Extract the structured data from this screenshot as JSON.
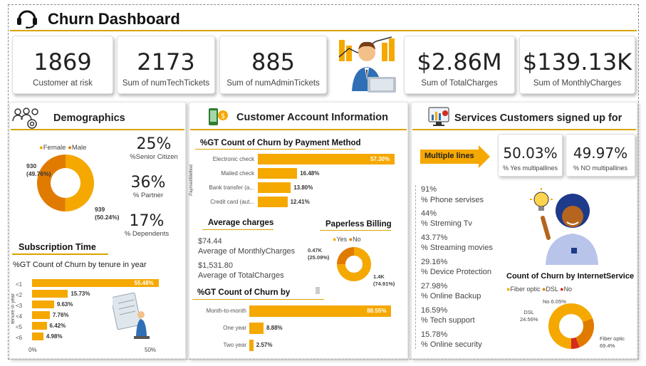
{
  "header": {
    "title": "Churn Dashboard"
  },
  "kpis": [
    {
      "value": "1869",
      "label": "Customer at risk"
    },
    {
      "value": "2173",
      "label": "Sum of numTechTickets"
    },
    {
      "value": "885",
      "label": "Sum of numAdminTickets"
    },
    {
      "value": "$2.86M",
      "label": "Sum of TotalCharges"
    },
    {
      "value": "$139.13K",
      "label": "Sum of MonthlyCharges"
    }
  ],
  "demographics": {
    "title": "Demographics",
    "legend": [
      "Female",
      "Male"
    ],
    "female_label": "939\n(50.24%)",
    "male_label": "930\n(49.76%)",
    "stats": [
      {
        "value": "25%",
        "label": "%Senior Citizen"
      },
      {
        "value": "36%",
        "label": "% Partner"
      },
      {
        "value": "17%",
        "label": "% Dependents"
      }
    ],
    "subscription_title": "Subscription Time",
    "tenure_title": "%GT Count of Churn by tenure in year",
    "tenure_axis": "tenure in year",
    "tenure_x_ticks": [
      "0%",
      "50%"
    ]
  },
  "account": {
    "title": "Customer Account Information",
    "payment_title": "%GT Count of Churn by Payment Method",
    "payment_axis": "PaymentMethod",
    "avg_title": "Average charges",
    "avg_monthly_value": "$74.44",
    "avg_monthly_label": "Average of MonthlyCharges",
    "avg_total_value": "$1,531.80",
    "avg_total_label": "Average of TotalCharges",
    "paperless_title": "Paperless Billing",
    "paperless_legend": [
      "Yes",
      "No"
    ],
    "paperless_no_label": "0.47K\n(25.09%)",
    "paperless_yes_label": "1.4K\n(74.91%)",
    "contract_title": "%GT Count of Churn by"
  },
  "services": {
    "title": "Services Customers signed up for",
    "multiple_lines": "Multiple lines",
    "yes_multi_value": "50.03%",
    "yes_multi_label": "% Yes multipallines",
    "no_multi_value": "49.97%",
    "no_multi_label": "% NO multipallines",
    "list": [
      {
        "pct": "91%",
        "label": "% Phone servises"
      },
      {
        "pct": "44%",
        "label": "% Streming Tv"
      },
      {
        "pct": "43.77%",
        "label": "% Streaming movies"
      },
      {
        "pct": "29.16%",
        "label": "% Device Protection"
      },
      {
        "pct": "27.98%",
        "label": "% Online Backup"
      },
      {
        "pct": "16.59%",
        "label": "% Tech support"
      },
      {
        "pct": "15.78%",
        "label": "% Online security"
      }
    ],
    "internet_title": "Count of Churn by InternetService",
    "internet_legend": [
      "Fiber optic",
      "DSL",
      "No"
    ],
    "internet_labels": {
      "no": "No 6.05%",
      "dsl": "DSL\n24.56%",
      "fiber": "Fiber optic\n69.4%"
    }
  },
  "colors": {
    "accent": "#f5a800",
    "dark": "#e07b00",
    "red": "#d62b1f"
  },
  "chart_data": [
    {
      "type": "pie",
      "title": "",
      "categories": [
        "Female",
        "Male"
      ],
      "values": [
        939,
        930
      ],
      "percent": [
        50.24,
        49.76
      ]
    },
    {
      "type": "bar",
      "title": "%GT Count of Churn by tenure in year",
      "categories": [
        "<1",
        "<2",
        "<3",
        "<4",
        "<5",
        "<6"
      ],
      "values": [
        55.48,
        15.73,
        9.63,
        7.76,
        6.42,
        4.98
      ],
      "labels": [
        "55.48%",
        "15.73%",
        "9.63%",
        "7.76%",
        "6.42%",
        "4.98%"
      ],
      "ylabel": "tenure in year",
      "xlim": [
        0,
        60
      ]
    },
    {
      "type": "bar",
      "title": "%GT Count of Churn by Payment Method",
      "categories": [
        "Electronic check",
        "Mailed check",
        "Bank transfer (a...",
        "Credit card (aut..."
      ],
      "values": [
        57.3,
        16.48,
        13.8,
        12.41
      ],
      "labels": [
        "57.30%",
        "16.48%",
        "13.80%",
        "12.41%"
      ],
      "ylabel": "PaymentMethod"
    },
    {
      "type": "pie",
      "title": "Paperless Billing",
      "categories": [
        "Yes",
        "No"
      ],
      "values": [
        1400,
        470
      ],
      "percent": [
        74.91,
        25.09
      ]
    },
    {
      "type": "bar",
      "title": "%GT Count of Churn by",
      "categories": [
        "Month-to-month",
        "One year",
        "Two year"
      ],
      "values": [
        88.55,
        8.88,
        2.57
      ],
      "labels": [
        "88.55%",
        "8.88%",
        "2.57%"
      ]
    },
    {
      "type": "pie",
      "title": "Count of Churn by InternetService",
      "categories": [
        "Fiber optic",
        "DSL",
        "No"
      ],
      "percent": [
        69.4,
        24.56,
        6.05
      ]
    }
  ]
}
